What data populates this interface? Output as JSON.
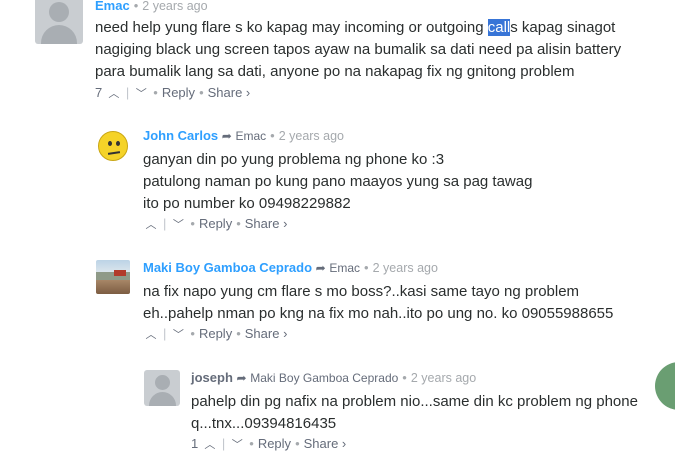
{
  "comments": [
    {
      "author": "Emac",
      "reply_to": "",
      "time": "2 years ago",
      "lines": [
        {
          "pre": "need help yung flare s ko kapag may incoming or outgoing ",
          "hl": "call",
          "post": "s kapag sinagot"
        },
        {
          "pre": "nagiging black ung screen tapos ayaw na bumalik sa dati need pa alisin battery",
          "hl": "",
          "post": ""
        },
        {
          "pre": "para bumalik lang sa dati, anyone po na nakapag fix ng gnitong problem",
          "hl": "",
          "post": ""
        }
      ],
      "votes": "7",
      "reply_label": "Reply",
      "share_label": "Share ›"
    },
    {
      "author": "John Carlos",
      "reply_to": "Emac",
      "time": "2 years ago",
      "lines": [
        {
          "pre": "ganyan din po yung problema ng phone ko :3",
          "hl": "",
          "post": ""
        },
        {
          "pre": "patulong naman po kung pano maayos yung sa pag tawag",
          "hl": "",
          "post": ""
        },
        {
          "pre": "ito po number ko 09498229882",
          "hl": "",
          "post": ""
        }
      ],
      "votes": "",
      "reply_label": "Reply",
      "share_label": "Share ›"
    },
    {
      "author": "Maki Boy Gamboa Ceprado",
      "reply_to": "Emac",
      "time": "2 years ago",
      "lines": [
        {
          "pre": "na fix napo yung cm flare s mo boss?..kasi same tayo ng problem",
          "hl": "",
          "post": ""
        },
        {
          "pre": "eh..pahelp nman po kng na fix mo nah..ito po ung no. ko 09055988655",
          "hl": "",
          "post": ""
        }
      ],
      "votes": "",
      "reply_label": "Reply",
      "share_label": "Share ›"
    },
    {
      "author": "joseph",
      "reply_to": "Maki Boy Gamboa Ceprado",
      "time": "2 years ago",
      "lines": [
        {
          "pre": "pahelp din pg nafix na problem nio...same din kc problem ng phone",
          "hl": "",
          "post": ""
        },
        {
          "pre": "q...tnx...09394816435",
          "hl": "",
          "post": ""
        }
      ],
      "votes": "1",
      "reply_label": "Reply",
      "share_label": "Share ›"
    }
  ],
  "icons": {
    "upvote": "chevron-up-icon",
    "downvote": "chevron-down-icon",
    "reply_arrow": "reply-arrow-icon",
    "avatar_default": "default-avatar-icon"
  },
  "colors": {
    "author": "#2e9fff",
    "muted": "#656c7a",
    "time": "#a5a9ad",
    "selection": "#3875d7"
  }
}
